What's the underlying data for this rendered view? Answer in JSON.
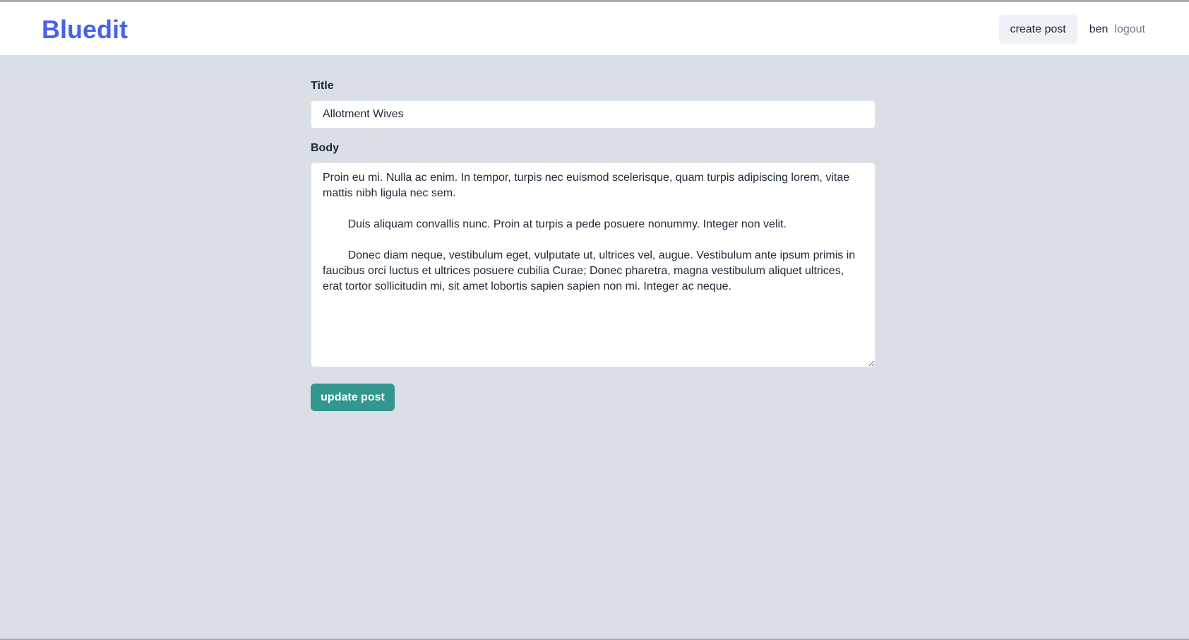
{
  "header": {
    "brand": "Bluedit",
    "create_post_label": "create post",
    "username": "ben",
    "logout_label": "logout"
  },
  "form": {
    "title_label": "Title",
    "title_value": "Allotment Wives",
    "body_label": "Body",
    "body_value": "Proin eu mi. Nulla ac enim. In tempor, turpis nec euismod scelerisque, quam turpis adipiscing lorem, vitae mattis nibh ligula nec sem.\n\n\tDuis aliquam convallis nunc. Proin at turpis a pede posuere nonummy. Integer non velit.\n\n\tDonec diam neque, vestibulum eget, vulputate ut, ultrices vel, augue. Vestibulum ante ipsum primis in faucibus orci luctus et ultrices posuere cubilia Curae; Donec pharetra, magna vestibulum aliquet ultrices, erat tortor sollicitudin mi, sit amet lobortis sapien sapien non mi. Integer ac neque.",
    "submit_label": "update post"
  },
  "colors": {
    "brand": "#4664e8",
    "background": "#dadfe6",
    "submit_button": "#31978f",
    "create_button_bg": "#eef2f6"
  }
}
